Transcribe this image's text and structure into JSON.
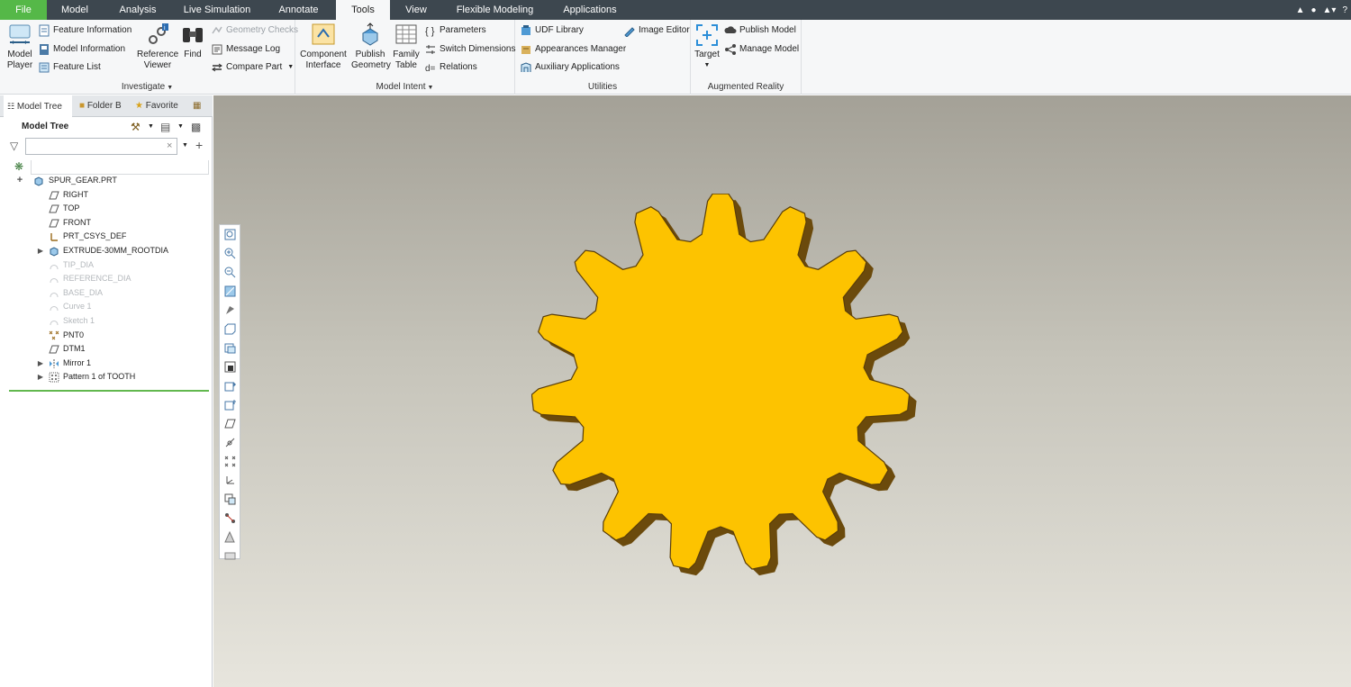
{
  "tabs": [
    {
      "label": "File",
      "kind": "file"
    },
    {
      "label": "Model"
    },
    {
      "label": "Analysis"
    },
    {
      "label": "Live Simulation"
    },
    {
      "label": "Annotate"
    },
    {
      "label": "Tools",
      "kind": "active"
    },
    {
      "label": "View"
    },
    {
      "label": "Flexible Modeling"
    },
    {
      "label": "Applications"
    }
  ],
  "ribbon": {
    "investigate": {
      "label": "Investigate",
      "model_player": "Model\nPlayer",
      "feature_information": "Feature Information",
      "model_information": "Model Information",
      "feature_list": "Feature List",
      "reference_viewer": "Reference\nViewer",
      "find": "Find",
      "geometry_checks": "Geometry Checks",
      "message_log": "Message Log",
      "compare_part": "Compare Part"
    },
    "model_intent": {
      "label": "Model Intent",
      "component_interface": "Component\nInterface",
      "publish_geometry": "Publish\nGeometry",
      "family_table": "Family\nTable",
      "parameters": "Parameters",
      "switch_dimensions": "Switch Dimensions",
      "relations": "Relations"
    },
    "utilities": {
      "label": "Utilities",
      "udf_library": "UDF Library",
      "appearances_manager": "Appearances Manager",
      "auxiliary_applications": "Auxiliary Applications",
      "image_editor": "Image Editor"
    },
    "augmented_reality": {
      "label": "Augmented Reality",
      "target": "Target",
      "publish_model": "Publish Model",
      "manage_model": "Manage Model"
    }
  },
  "panel": {
    "tabs": [
      "Model Tree",
      "Folder B",
      "Favorite"
    ],
    "title": "Model Tree",
    "search_value": ""
  },
  "tree": {
    "root": "SPUR_GEAR.PRT",
    "items": [
      {
        "label": "RIGHT",
        "icon": "datum-plane-icon",
        "state": "normal"
      },
      {
        "label": "TOP",
        "icon": "datum-plane-icon",
        "state": "normal"
      },
      {
        "label": "FRONT",
        "icon": "datum-plane-icon",
        "state": "normal"
      },
      {
        "label": "PRT_CSYS_DEF",
        "icon": "csys-icon",
        "state": "normal"
      },
      {
        "label": "EXTRUDE-30MM_ROOTDIA",
        "icon": "extrude-icon",
        "state": "normal",
        "expandable": true
      },
      {
        "label": "TIP_DIA",
        "icon": "curve-icon",
        "state": "dim"
      },
      {
        "label": "REFERENCE_DIA",
        "icon": "curve-icon",
        "state": "dim"
      },
      {
        "label": "BASE_DIA",
        "icon": "curve-icon",
        "state": "dim"
      },
      {
        "label": "Curve 1",
        "icon": "curve-icon",
        "state": "dim"
      },
      {
        "label": "Sketch 1",
        "icon": "curve-icon",
        "state": "dim"
      },
      {
        "label": "PNT0",
        "icon": "datum-point-icon",
        "state": "normal"
      },
      {
        "label": "DTM1",
        "icon": "datum-plane-icon",
        "state": "normal"
      },
      {
        "label": "Mirror 1",
        "icon": "mirror-icon",
        "state": "normal",
        "expandable": true
      },
      {
        "label": "Pattern 1 of TOOTH",
        "icon": "pattern-icon",
        "state": "normal",
        "expandable": true
      }
    ]
  },
  "colors": {
    "file_tab": "#55b848",
    "tabbar": "#3d474f",
    "gear_face": "#fdc300",
    "gear_side": "#6b4a0c",
    "insert_line": "#62b84e"
  },
  "gear": {
    "teeth": 15
  }
}
